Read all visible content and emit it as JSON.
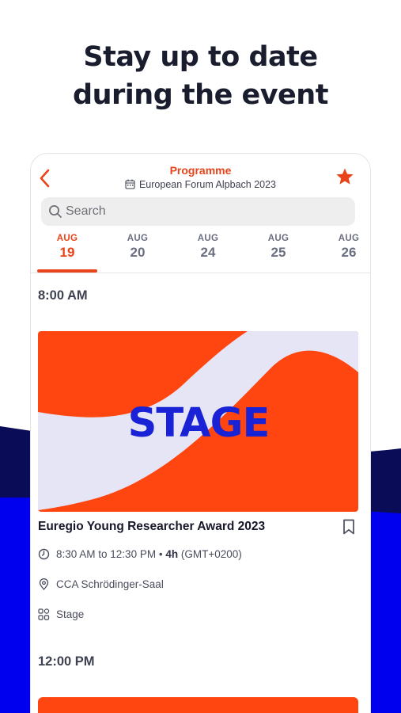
{
  "headline": {
    "line1": "Stay up to date",
    "line2": "during the event"
  },
  "colors": {
    "accent": "#e8431a",
    "banner_orange": "#ff4510",
    "banner_lilac": "#e6e5f6",
    "stage_blue": "#1a22d6",
    "wave_navy": "#0a0c57",
    "wave_blue": "#0000ee"
  },
  "app": {
    "title": "Programme",
    "subtitle": "European Forum Alpbach 2023",
    "icons": {
      "back": "chevron-left-icon",
      "favorite": "star-icon",
      "calendar": "calendar-icon",
      "search": "search-icon"
    },
    "search": {
      "placeholder": "Search",
      "value": ""
    },
    "dates": [
      {
        "month": "AUG",
        "day": "19",
        "selected": true
      },
      {
        "month": "AUG",
        "day": "20",
        "selected": false
      },
      {
        "month": "AUG",
        "day": "24",
        "selected": false
      },
      {
        "month": "AUG",
        "day": "25",
        "selected": false
      },
      {
        "month": "AUG",
        "day": "26",
        "selected": false
      }
    ],
    "slots": [
      {
        "time": "8:00 AM",
        "event": {
          "banner_text": "STAGE",
          "title": "Euregio Young Researcher Award 2023",
          "time_range": "8:30 AM to 12:30 PM",
          "separator": "•",
          "duration": "4h",
          "timezone": "(GMT+0200)",
          "location": "CCA Schrödinger-Saal",
          "format": "Stage",
          "icons": {
            "bookmark": "bookmark-icon",
            "clock": "clock-icon",
            "location": "map-pin-icon",
            "format": "grid-icon"
          }
        }
      },
      {
        "time": "12:00 PM"
      }
    ]
  }
}
